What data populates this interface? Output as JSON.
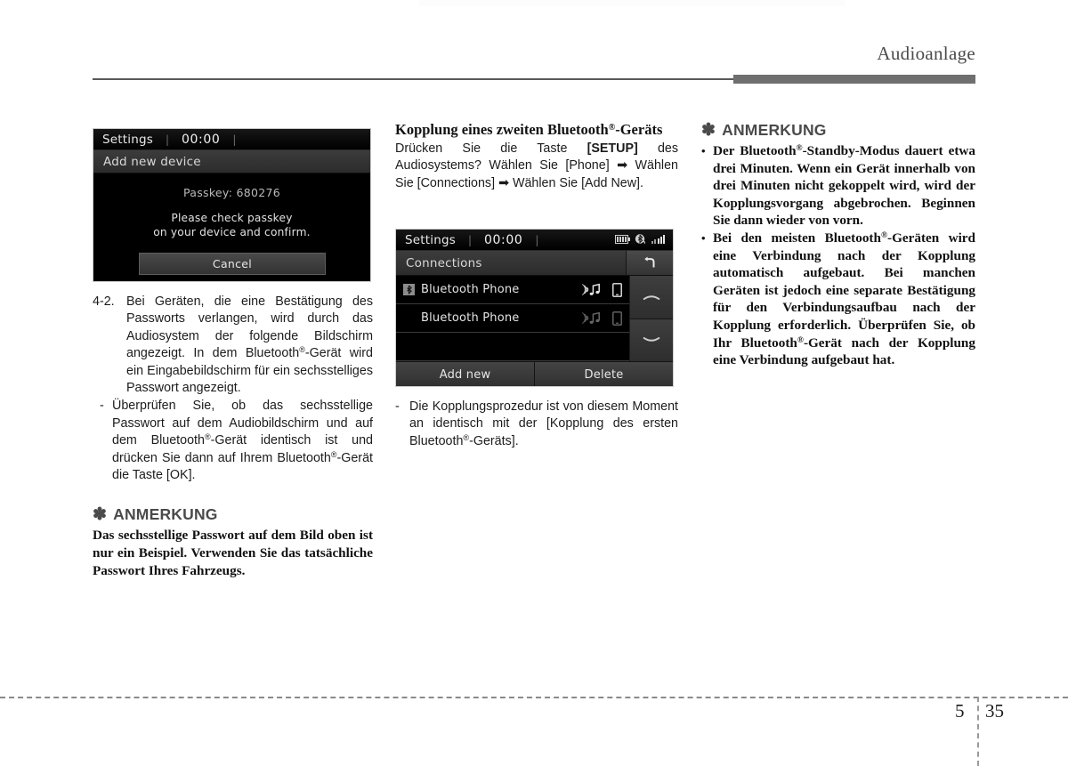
{
  "header": {
    "title": "Audioanlage"
  },
  "footer": {
    "chapter": "5",
    "page": "35"
  },
  "screen_passkey": {
    "status_label": "Settings",
    "separator": "|",
    "clock": "00:00",
    "sub_title": "Add new device",
    "passkey_line": "Passkey: 680276",
    "message_line_1": "Please check passkey",
    "message_line_2": "on your device and confirm.",
    "cancel_label": "Cancel"
  },
  "screen_connections": {
    "status_label": "Settings",
    "separator": "|",
    "clock": "00:00",
    "sub_title": "Connections",
    "back_icon": "back-arrow-icon",
    "status_icons": [
      "battery-icon",
      "bluetooth-icon",
      "signal-icon"
    ],
    "rows": [
      {
        "badge": "bluetooth-badge-icon",
        "name": "Bluetooth Phone",
        "icons": [
          "audio-stream-icon",
          "phone-icon"
        ],
        "active": true
      },
      {
        "badge": "",
        "name": "Bluetooth Phone",
        "icons": [
          "audio-stream-icon",
          "phone-icon"
        ],
        "active": false
      }
    ],
    "scroll_up_icon": "chevron-up-icon",
    "scroll_down_icon": "chevron-down-icon",
    "button_add": "Add new",
    "button_delete": "Delete"
  },
  "column_1": {
    "step_marker": "4-2.",
    "step_text_a": "Bei Geräten, die eine Bestätigung des Passworts verlangen, wird durch das Audiosystem der folgende Bildschirm angezeigt. In dem Bluetooth",
    "step_text_b": "-Gerät wird ein Eingabebildschirm für ein sechsstelliges Passwort angezeigt.",
    "dash_marker": "-",
    "dash_text_a": "Überprüfen Sie, ob das sechsstellige Passwort auf dem Audiobildschirm und auf dem Bluetooth",
    "dash_text_b": "-Gerät identisch ist und drücken Sie dann auf Ihrem Bluetooth",
    "dash_text_c": "-Gerät die Taste [OK].",
    "note_asterisk": "✽",
    "note_title": "ANMERKUNG",
    "note_text": "Das sechsstellige Passwort auf dem Bild oben ist nur ein Beispiel. Verwenden Sie das tatsächliche Passwort Ihres Fahrzeugs."
  },
  "column_2": {
    "subhead_a": "Kopplung eines zweiten Bluetooth",
    "subhead_b": "-Geräts",
    "intro_a": "Drücken Sie die Taste ",
    "intro_bold": "[SETUP]",
    "intro_b": " des Audiosystems? Wählen Sie [Phone] ",
    "arrow_1": "➡",
    "intro_c": " Wählen Sie [Connections] ",
    "arrow_2": "➡",
    "intro_d": " Wählen Sie [Add New].",
    "dash_marker": "-",
    "dash_text_a": "Die Kopplungsprozedur ist von diesem Moment an identisch mit der [Kopplung des ersten Bluetooth",
    "dash_text_b": "-Geräts]."
  },
  "column_3": {
    "note_asterisk": "✽",
    "note_title": "ANMERKUNG",
    "bullet": "•",
    "item_1_a": "Der Bluetooth",
    "item_1_b": "-Standby-Modus dauert etwa drei Minuten. Wenn ein Gerät innerhalb von drei Minuten nicht gekoppelt wird, wird der Kopplungsvorgang abgebrochen. Beginnen Sie dann wieder von vorn.",
    "item_2_a": "Bei den meisten Bluetooth",
    "item_2_b": "-Geräten wird eine Verbindung nach der Kopplung automatisch aufgebaut. Bei manchen Geräten ist jedoch eine separate Bestätigung für den Verbindungsaufbau nach der Kopplung erforderlich. Überprüfen Sie, ob Ihr Bluetooth",
    "item_2_c": "-Gerät nach der Kopplung eine Verbindung aufgebaut hat."
  },
  "symbols": {
    "registered": "®"
  },
  "colors": {
    "rule": "#595959",
    "rule_thick": "#6f6f6f",
    "note_head": "#4a4a4a",
    "screen_bg": "#000000"
  }
}
